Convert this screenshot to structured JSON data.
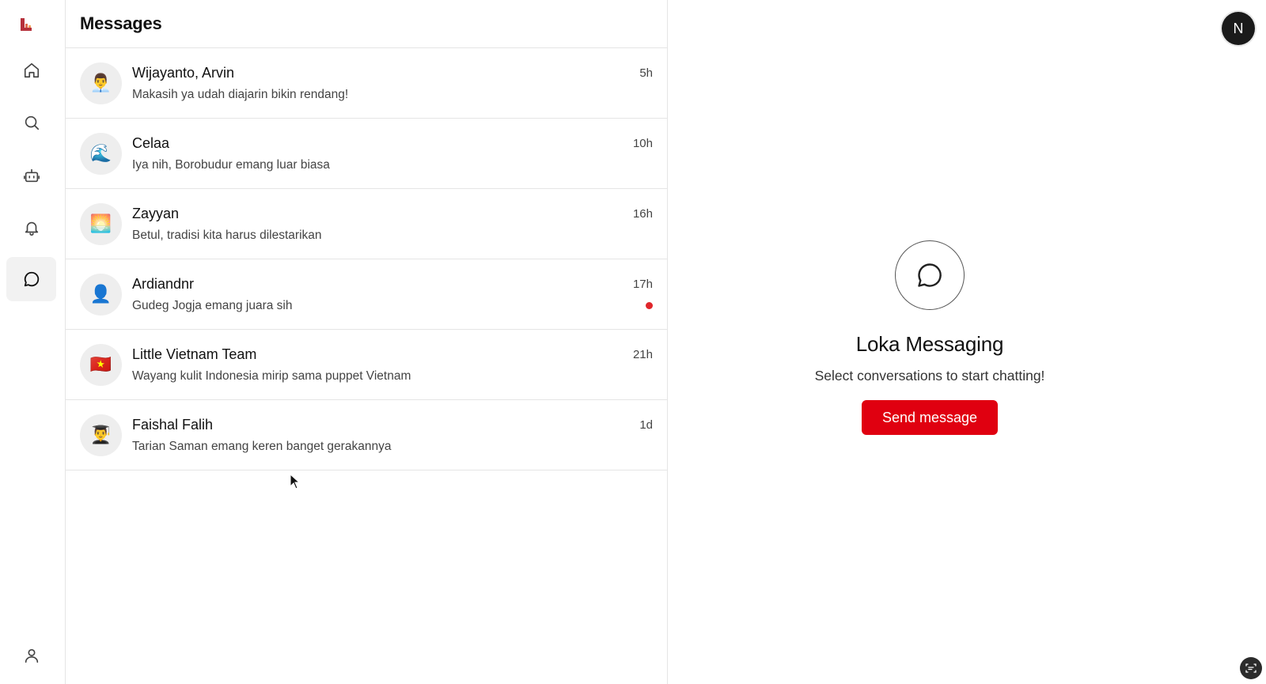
{
  "app": {
    "brand_color": "#e00010",
    "unread_color": "#e0262b"
  },
  "rail": {
    "items": [
      {
        "name": "home",
        "icon": "home-icon",
        "active": false
      },
      {
        "name": "search",
        "icon": "search-icon",
        "active": false
      },
      {
        "name": "bot",
        "icon": "bot-icon",
        "active": false
      },
      {
        "name": "notifications",
        "icon": "bell-icon",
        "active": false
      },
      {
        "name": "messages",
        "icon": "chat-bubble-icon",
        "active": true
      },
      {
        "name": "profile",
        "icon": "user-icon",
        "active": false
      }
    ]
  },
  "list": {
    "title": "Messages",
    "conversations": [
      {
        "name": "Wijayanto, Arvin",
        "preview": "Makasih ya udah diajarin bikin rendang!",
        "time": "5h",
        "avatar": "👨‍💼",
        "unread": false
      },
      {
        "name": "Celaa",
        "preview": "Iya nih, Borobudur emang luar biasa",
        "time": "10h",
        "avatar": "🌊",
        "unread": false
      },
      {
        "name": "Zayyan",
        "preview": "Betul, tradisi kita harus dilestarikan",
        "time": "16h",
        "avatar": "🌅",
        "unread": false
      },
      {
        "name": "Ardiandnr",
        "preview": "Gudeg Jogja emang juara sih",
        "time": "17h",
        "avatar": "👤",
        "unread": true
      },
      {
        "name": "Little Vietnam Team",
        "preview": "Wayang kulit Indonesia mirip sama puppet Vietnam",
        "time": "21h",
        "avatar": "🇻🇳",
        "unread": false
      },
      {
        "name": "Faishal Falih",
        "preview": "Tarian Saman emang keren banget gerakannya",
        "time": "1d",
        "avatar": "👨‍🎓",
        "unread": false
      }
    ]
  },
  "main": {
    "title": "Loka Messaging",
    "subtitle": "Select conversations to start chatting!",
    "button_label": "Send message",
    "user_initial": "N"
  }
}
